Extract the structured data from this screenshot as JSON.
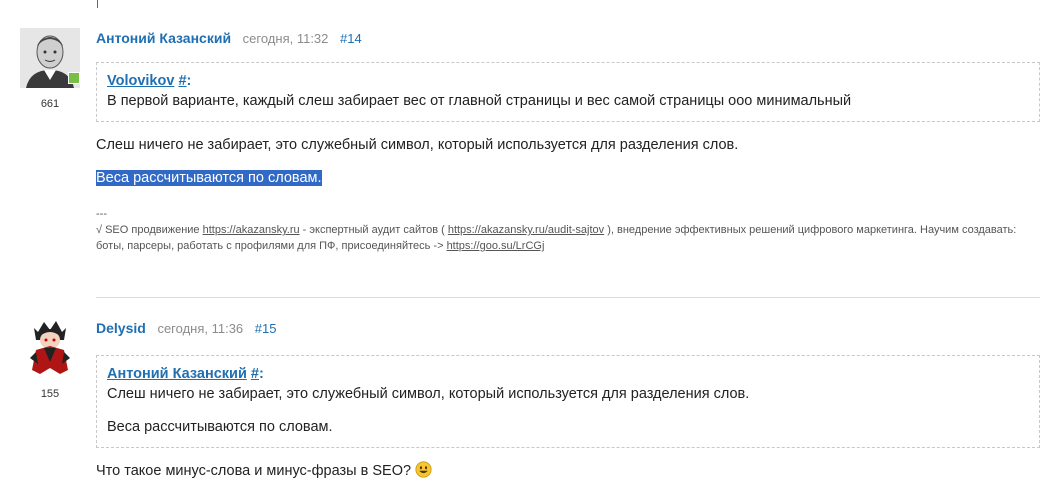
{
  "posts": [
    {
      "author": "Антоний Казанский",
      "date": "сегодня, 11:32",
      "number": "#14",
      "rep": "661",
      "quote": {
        "author": "Volovikov",
        "hash": "#",
        "colon": ":",
        "paragraphs": [
          "В первой варианте, каждый слеш забирает вес от главной страницы и вес самой страницы ооо минимальный"
        ]
      },
      "paragraphs": [
        "Слеш ничего не забирает, это служебный символ, который используется для разделения слов.",
        "Веса рассчитываются по словам."
      ],
      "signature": {
        "dashes": "---",
        "prefix": "√ SEO продвижение ",
        "link1": "https://akazansky.ru",
        "mid1": " - экспертный аудит сайтов ( ",
        "link2": "https://akazansky.ru/audit-sajtov",
        "mid2": " ), внедрение эффективных решений цифрового маркетинга. Научим создавать: боты, парсеры, работать с профилями для ПФ, присоединяйтесь -> ",
        "link3": "https://goo.su/LrCGj"
      }
    },
    {
      "author": "Delysid",
      "date": "сегодня, 11:36",
      "number": "#15",
      "rep": "155",
      "quote": {
        "author": "Антоний Казанский",
        "hash": "#",
        "colon": ":",
        "paragraphs": [
          "Слеш ничего не забирает, это служебный символ, который используется для разделения слов.",
          "Веса рассчитываются по словам."
        ]
      },
      "paragraphs": [
        "Что такое минус-слова и минус-фразы в SEO?"
      ]
    }
  ],
  "colors": {
    "link": "#1f6fb2",
    "selection": "#3169c6",
    "online": "#77c043"
  },
  "icons": {
    "smiley": "grinning-smiley-icon"
  }
}
